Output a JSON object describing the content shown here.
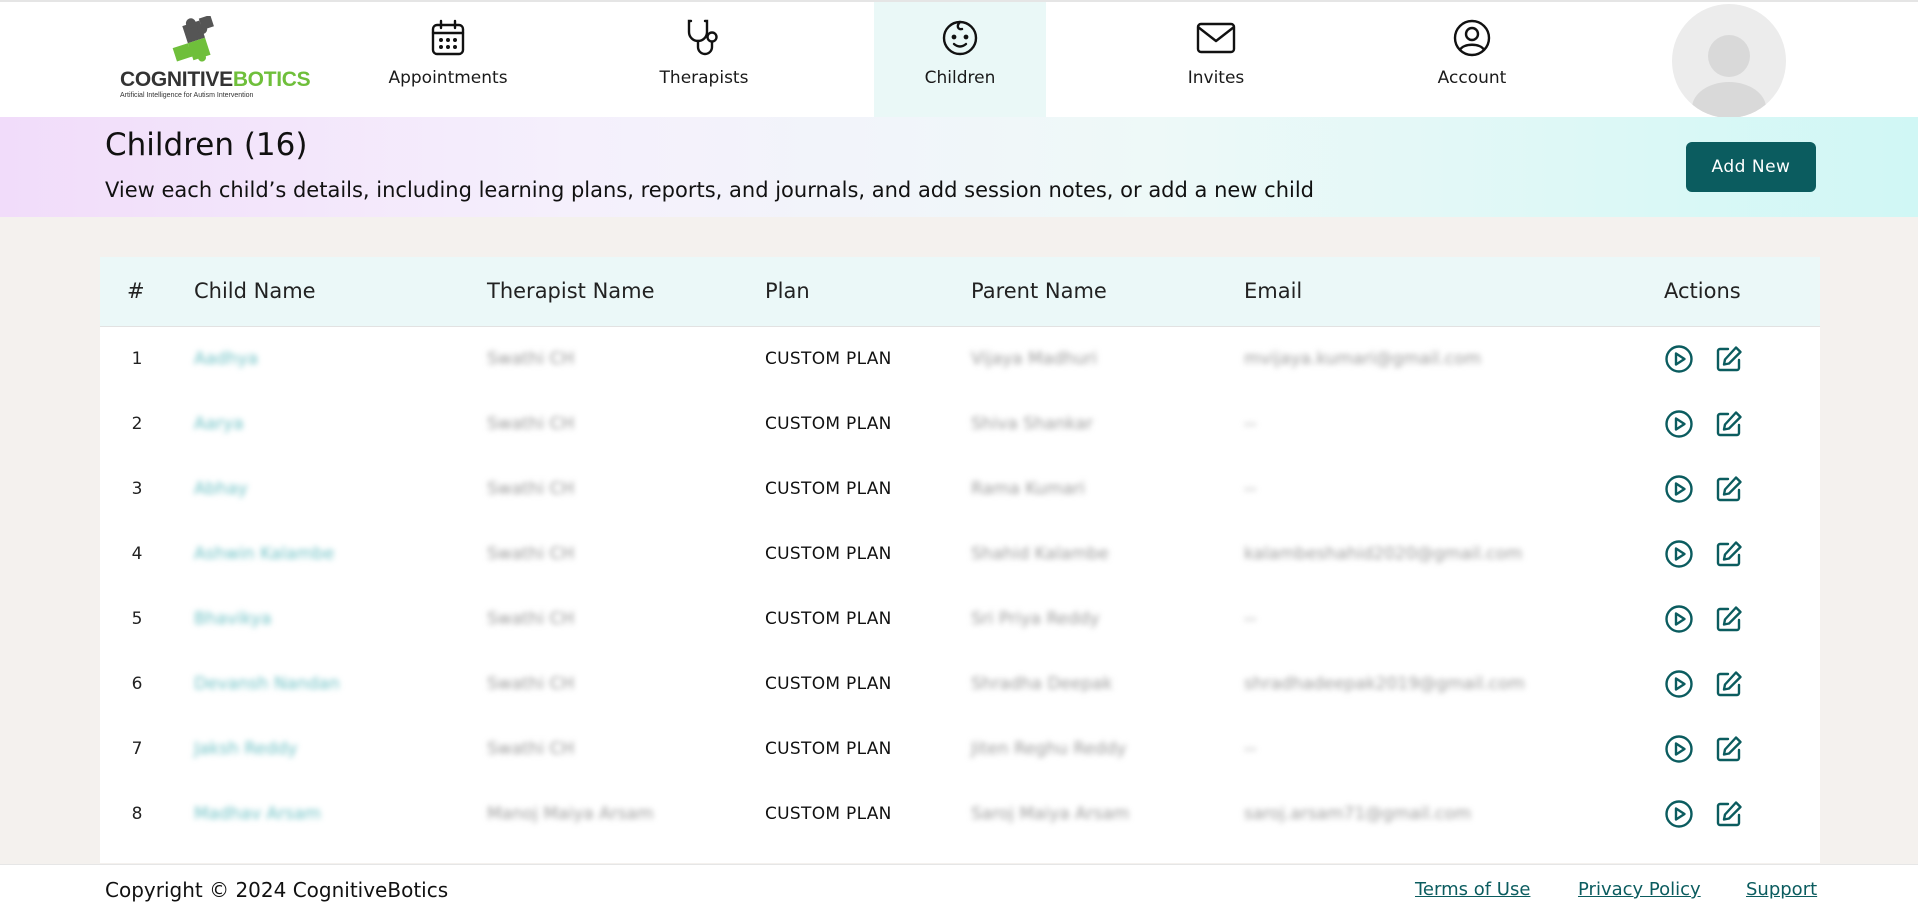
{
  "brand": {
    "logo_word_a": "COGNITIVE",
    "logo_word_b": "BOTICS",
    "logo_tagline": "Artificial Intelligence for Autism Intervention",
    "colors": {
      "dark": "#333333",
      "green": "#6fbf3b",
      "primary": "#0b5c5f"
    }
  },
  "nav": {
    "items": [
      {
        "label": "Appointments",
        "icon": "calendar-icon"
      },
      {
        "label": "Therapists",
        "icon": "stethoscope-icon"
      },
      {
        "label": "Children",
        "icon": "child-face-icon",
        "active": true
      },
      {
        "label": "Invites",
        "icon": "envelope-icon"
      },
      {
        "label": "Account",
        "icon": "user-circle-icon"
      }
    ]
  },
  "header": {
    "title": "Children (16)",
    "subtitle": "View each child’s details, including learning plans, reports, and journals, and add session notes, or add a new child",
    "add_button": "Add New"
  },
  "table": {
    "columns": [
      "#",
      "Child Name",
      "Therapist Name",
      "Plan",
      "Parent Name",
      "Email",
      "Actions"
    ],
    "rows": [
      {
        "index": "1",
        "child": "Aadhya",
        "therapist": "Swathi CH",
        "plan": "CUSTOM PLAN",
        "parent": "Vijaya Madhuri",
        "email": "mvijaya.kumari@gmail.com"
      },
      {
        "index": "2",
        "child": "Aarya",
        "therapist": "Swathi CH",
        "plan": "CUSTOM PLAN",
        "parent": "Shiva Shankar",
        "email": "--"
      },
      {
        "index": "3",
        "child": "Abhay",
        "therapist": "Swathi CH",
        "plan": "CUSTOM PLAN",
        "parent": "Rama Kumari",
        "email": "--"
      },
      {
        "index": "4",
        "child": "Ashwin Kalambe",
        "therapist": "Swathi CH",
        "plan": "CUSTOM PLAN",
        "parent": "Shahid Kalambe",
        "email": "kalambeshahid2020@gmail.com"
      },
      {
        "index": "5",
        "child": "Bhavikya",
        "therapist": "Swathi CH",
        "plan": "CUSTOM PLAN",
        "parent": "Sri Priya Reddy",
        "email": "--"
      },
      {
        "index": "6",
        "child": "Devansh Nandan",
        "therapist": "Swathi CH",
        "plan": "CUSTOM PLAN",
        "parent": "Shradha Deepak",
        "email": "shradhadeepak2019@gmail.com"
      },
      {
        "index": "7",
        "child": "Jaksh Reddy",
        "therapist": "Swathi CH",
        "plan": "CUSTOM PLAN",
        "parent": "Jiten Reghu Reddy",
        "email": "--"
      },
      {
        "index": "8",
        "child": "Madhav Arsam",
        "therapist": "Manoj Maiya Arsam",
        "plan": "CUSTOM PLAN",
        "parent": "Saroj Maiya Arsam",
        "email": "saroj.arsam71@gmail.com"
      }
    ]
  },
  "footer": {
    "copyright": "Copyright © 2024 CognitiveBotics",
    "links": [
      "Terms of Use",
      "Privacy Policy",
      "Support"
    ]
  }
}
